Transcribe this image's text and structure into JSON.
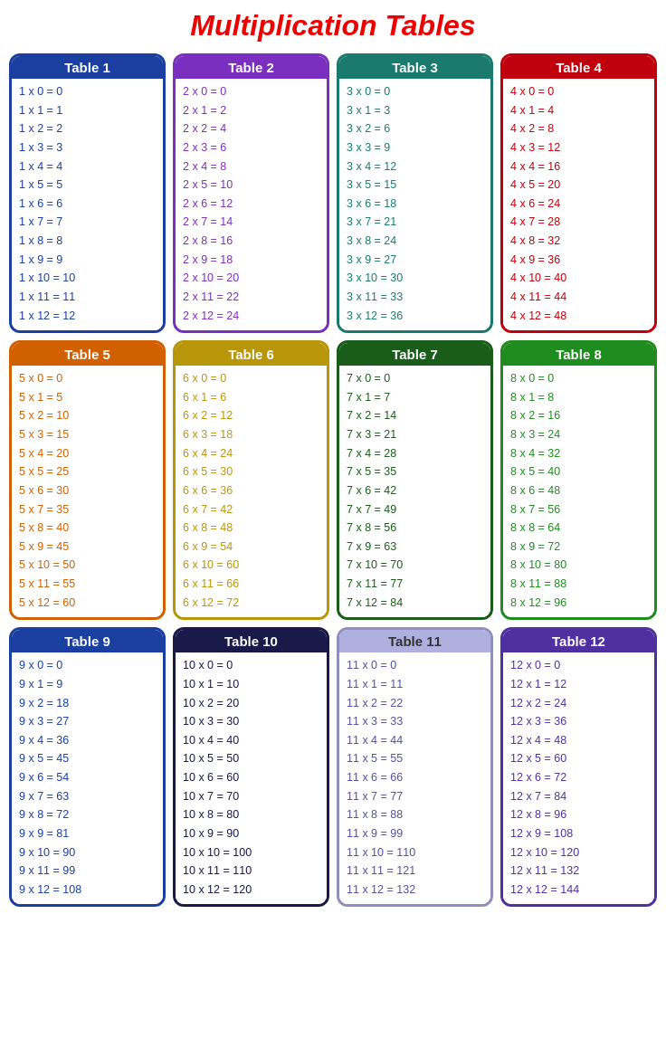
{
  "title": "Multiplication Tables",
  "tables": [
    {
      "id": 1,
      "label": "Table 1",
      "class": "t1",
      "rows": [
        "1 x 0 = 0",
        "1 x 1 = 1",
        "1 x 2 = 2",
        "1 x 3 = 3",
        "1 x 4 = 4",
        "1 x 5 = 5",
        "1 x 6 = 6",
        "1 x 7 = 7",
        "1 x 8 = 8",
        "1 x 9 = 9",
        "1 x 10 = 10",
        "1 x 11 = 11",
        "1 x 12 = 12"
      ]
    },
    {
      "id": 2,
      "label": "Table 2",
      "class": "t2",
      "rows": [
        "2 x 0 = 0",
        "2 x 1 = 2",
        "2 x 2 = 4",
        "2 x 3 = 6",
        "2 x 4 = 8",
        "2 x 5 = 10",
        "2 x 6 = 12",
        "2 x 7 = 14",
        "2 x 8 = 16",
        "2 x 9 = 18",
        "2 x 10 = 20",
        "2 x 11 = 22",
        "2 x 12 = 24"
      ]
    },
    {
      "id": 3,
      "label": "Table 3",
      "class": "t3",
      "rows": [
        "3 x 0 = 0",
        "3 x 1 = 3",
        "3 x 2 = 6",
        "3 x 3 = 9",
        "3 x 4 = 12",
        "3 x 5 = 15",
        "3 x 6 = 18",
        "3 x 7 = 21",
        "3 x 8 = 24",
        "3 x 9 = 27",
        "3 x 10 = 30",
        "3 x 11 = 33",
        "3 x 12 = 36"
      ]
    },
    {
      "id": 4,
      "label": "Table 4",
      "class": "t4",
      "rows": [
        "4 x 0 = 0",
        "4 x 1 = 4",
        "4 x 2 = 8",
        "4 x 3 = 12",
        "4 x 4 = 16",
        "4 x 5 = 20",
        "4 x 6 = 24",
        "4 x 7 = 28",
        "4 x 8 = 32",
        "4 x 9 = 36",
        "4 x 10 = 40",
        "4 x 11 = 44",
        "4 x 12 = 48"
      ]
    },
    {
      "id": 5,
      "label": "Table 5",
      "class": "t5",
      "rows": [
        "5 x 0 = 0",
        "5 x 1 = 5",
        "5 x 2 = 10",
        "5 x 3 = 15",
        "5 x 4 = 20",
        "5 x 5 = 25",
        "5 x 6 = 30",
        "5 x 7 = 35",
        "5 x 8 = 40",
        "5 x 9 = 45",
        "5 x 10 = 50",
        "5 x 11 = 55",
        "5 x 12 = 60"
      ]
    },
    {
      "id": 6,
      "label": "Table 6",
      "class": "t6",
      "rows": [
        "6 x 0 = 0",
        "6 x 1 = 6",
        "6 x 2 = 12",
        "6 x 3 = 18",
        "6 x 4 = 24",
        "6 x 5 = 30",
        "6 x 6 = 36",
        "6 x 7 = 42",
        "6 x 8 = 48",
        "6 x 9 = 54",
        "6 x 10 = 60",
        "6 x 11 = 66",
        "6 x 12 = 72"
      ]
    },
    {
      "id": 7,
      "label": "Table 7",
      "class": "t7",
      "rows": [
        "7 x 0 = 0",
        "7 x 1 = 7",
        "7 x 2 = 14",
        "7 x 3 = 21",
        "7 x 4 = 28",
        "7 x 5 = 35",
        "7 x 6 = 42",
        "7 x 7 = 49",
        "7 x 8 = 56",
        "7 x 9 = 63",
        "7 x 10 = 70",
        "7 x 11 = 77",
        "7 x 12 = 84"
      ]
    },
    {
      "id": 8,
      "label": "Table 8",
      "class": "t8",
      "rows": [
        "8 x 0 = 0",
        "8 x 1 = 8",
        "8 x 2 = 16",
        "8 x 3 = 24",
        "8 x 4 = 32",
        "8 x 5 = 40",
        "8 x 6 = 48",
        "8 x 7 = 56",
        "8 x 8 = 64",
        "8 x 9 = 72",
        "8 x 10 = 80",
        "8 x 11 = 88",
        "8 x 12 = 96"
      ]
    },
    {
      "id": 9,
      "label": "Table 9",
      "class": "t9",
      "rows": [
        "9 x 0 = 0",
        "9 x 1 = 9",
        "9 x 2 = 18",
        "9 x 3 = 27",
        "9 x 4 = 36",
        "9 x 5 = 45",
        "9 x 6 = 54",
        "9 x 7 = 63",
        "9 x 8 = 72",
        "9 x 9 = 81",
        "9 x 10 = 90",
        "9 x 11 = 99",
        "9 x 12 = 108"
      ]
    },
    {
      "id": 10,
      "label": "Table 10",
      "class": "t10",
      "rows": [
        "10 x 0 = 0",
        "10 x 1 = 10",
        "10 x 2 = 20",
        "10 x 3 = 30",
        "10 x 4 = 40",
        "10 x 5 = 50",
        "10 x 6 = 60",
        "10 x 7 = 70",
        "10 x 8 = 80",
        "10 x 9 = 90",
        "10 x 10 = 100",
        "10 x 11 = 110",
        "10 x 12 = 120"
      ]
    },
    {
      "id": 11,
      "label": "Table 11",
      "class": "t11",
      "rows": [
        "11 x 0 = 0",
        "11 x 1 = 11",
        "11 x 2 = 22",
        "11 x 3 = 33",
        "11 x 4 = 44",
        "11 x 5 = 55",
        "11 x 6 = 66",
        "11 x 7 = 77",
        "11 x 8 = 88",
        "11 x 9 = 99",
        "11 x 10 = 110",
        "11 x 11 = 121",
        "11 x 12 = 132"
      ]
    },
    {
      "id": 12,
      "label": "Table 12",
      "class": "t12",
      "rows": [
        "12 x 0 = 0",
        "12 x 1 = 12",
        "12 x 2 = 24",
        "12 x 3 = 36",
        "12 x 4 = 48",
        "12 x 5 = 60",
        "12 x 6 = 72",
        "12 x 7 = 84",
        "12 x 8 = 96",
        "12 x 9 = 108",
        "12 x 10 = 120",
        "12 x 11 = 132",
        "12 x 12 = 144"
      ]
    }
  ]
}
